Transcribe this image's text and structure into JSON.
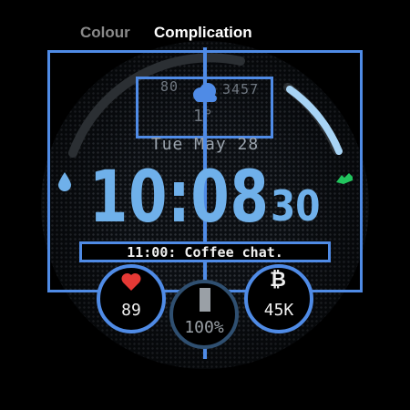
{
  "tabs": [
    {
      "label": "Colour"
    },
    {
      "label": "Complication"
    }
  ],
  "weather": {
    "left_value": "80",
    "right_value": "3457",
    "temperature": "1°",
    "icon": "cloud-icon"
  },
  "date": "Tue May 28",
  "time": {
    "hours_minutes": "10:08",
    "seconds": "30"
  },
  "event": "11:00: Coffee chat.",
  "complications": {
    "heart_rate": {
      "icon": "heart-icon",
      "value": "89"
    },
    "battery": {
      "value": "100%",
      "level_percent": 100
    },
    "bitcoin": {
      "icon": "bitcoin-icon",
      "value": "45K"
    }
  },
  "side_icons": {
    "left": "water-drop-icon",
    "right": "shoe-icon"
  },
  "colors": {
    "accent": "#4f8be6",
    "time": "#6fb0ea",
    "arc": "#a8d4f5",
    "heart": "#e53935",
    "shoe": "#22c55e",
    "drop": "#6fb0ea"
  }
}
